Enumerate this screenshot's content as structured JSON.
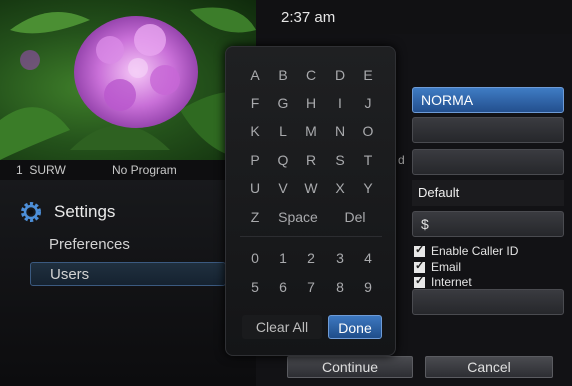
{
  "clock": "2:37 am",
  "channel_bar": {
    "number": "1",
    "callsign": "SURW",
    "program": "No Program"
  },
  "menu": {
    "title": "Settings",
    "items": [
      {
        "label": "Preferences"
      },
      {
        "label": "Users"
      }
    ]
  },
  "form": {
    "name_value": "NORMA",
    "partial_label": "d",
    "default_value": "Default",
    "currency_prefix": "$",
    "checkboxes": [
      {
        "label": "Enable Caller ID",
        "checked": true
      },
      {
        "label": "Email",
        "checked": true
      },
      {
        "label": "Internet",
        "checked": true
      }
    ],
    "continue_label": "Continue",
    "cancel_label": "Cancel"
  },
  "keyboard": {
    "letters": [
      [
        "A",
        "B",
        "C",
        "D",
        "E"
      ],
      [
        "F",
        "G",
        "H",
        "I",
        "J"
      ],
      [
        "K",
        "L",
        "M",
        "N",
        "O"
      ],
      [
        "P",
        "Q",
        "R",
        "S",
        "T"
      ],
      [
        "U",
        "V",
        "W",
        "X",
        "Y"
      ]
    ],
    "z": "Z",
    "space": "Space",
    "del": "Del",
    "digits": [
      [
        "0",
        "1",
        "2",
        "3",
        "4"
      ],
      [
        "5",
        "6",
        "7",
        "8",
        "9"
      ]
    ],
    "clear_all": "Clear All",
    "done": "Done"
  },
  "colors": {
    "accent": "#2f63a8",
    "background": "#0b0b0c"
  }
}
